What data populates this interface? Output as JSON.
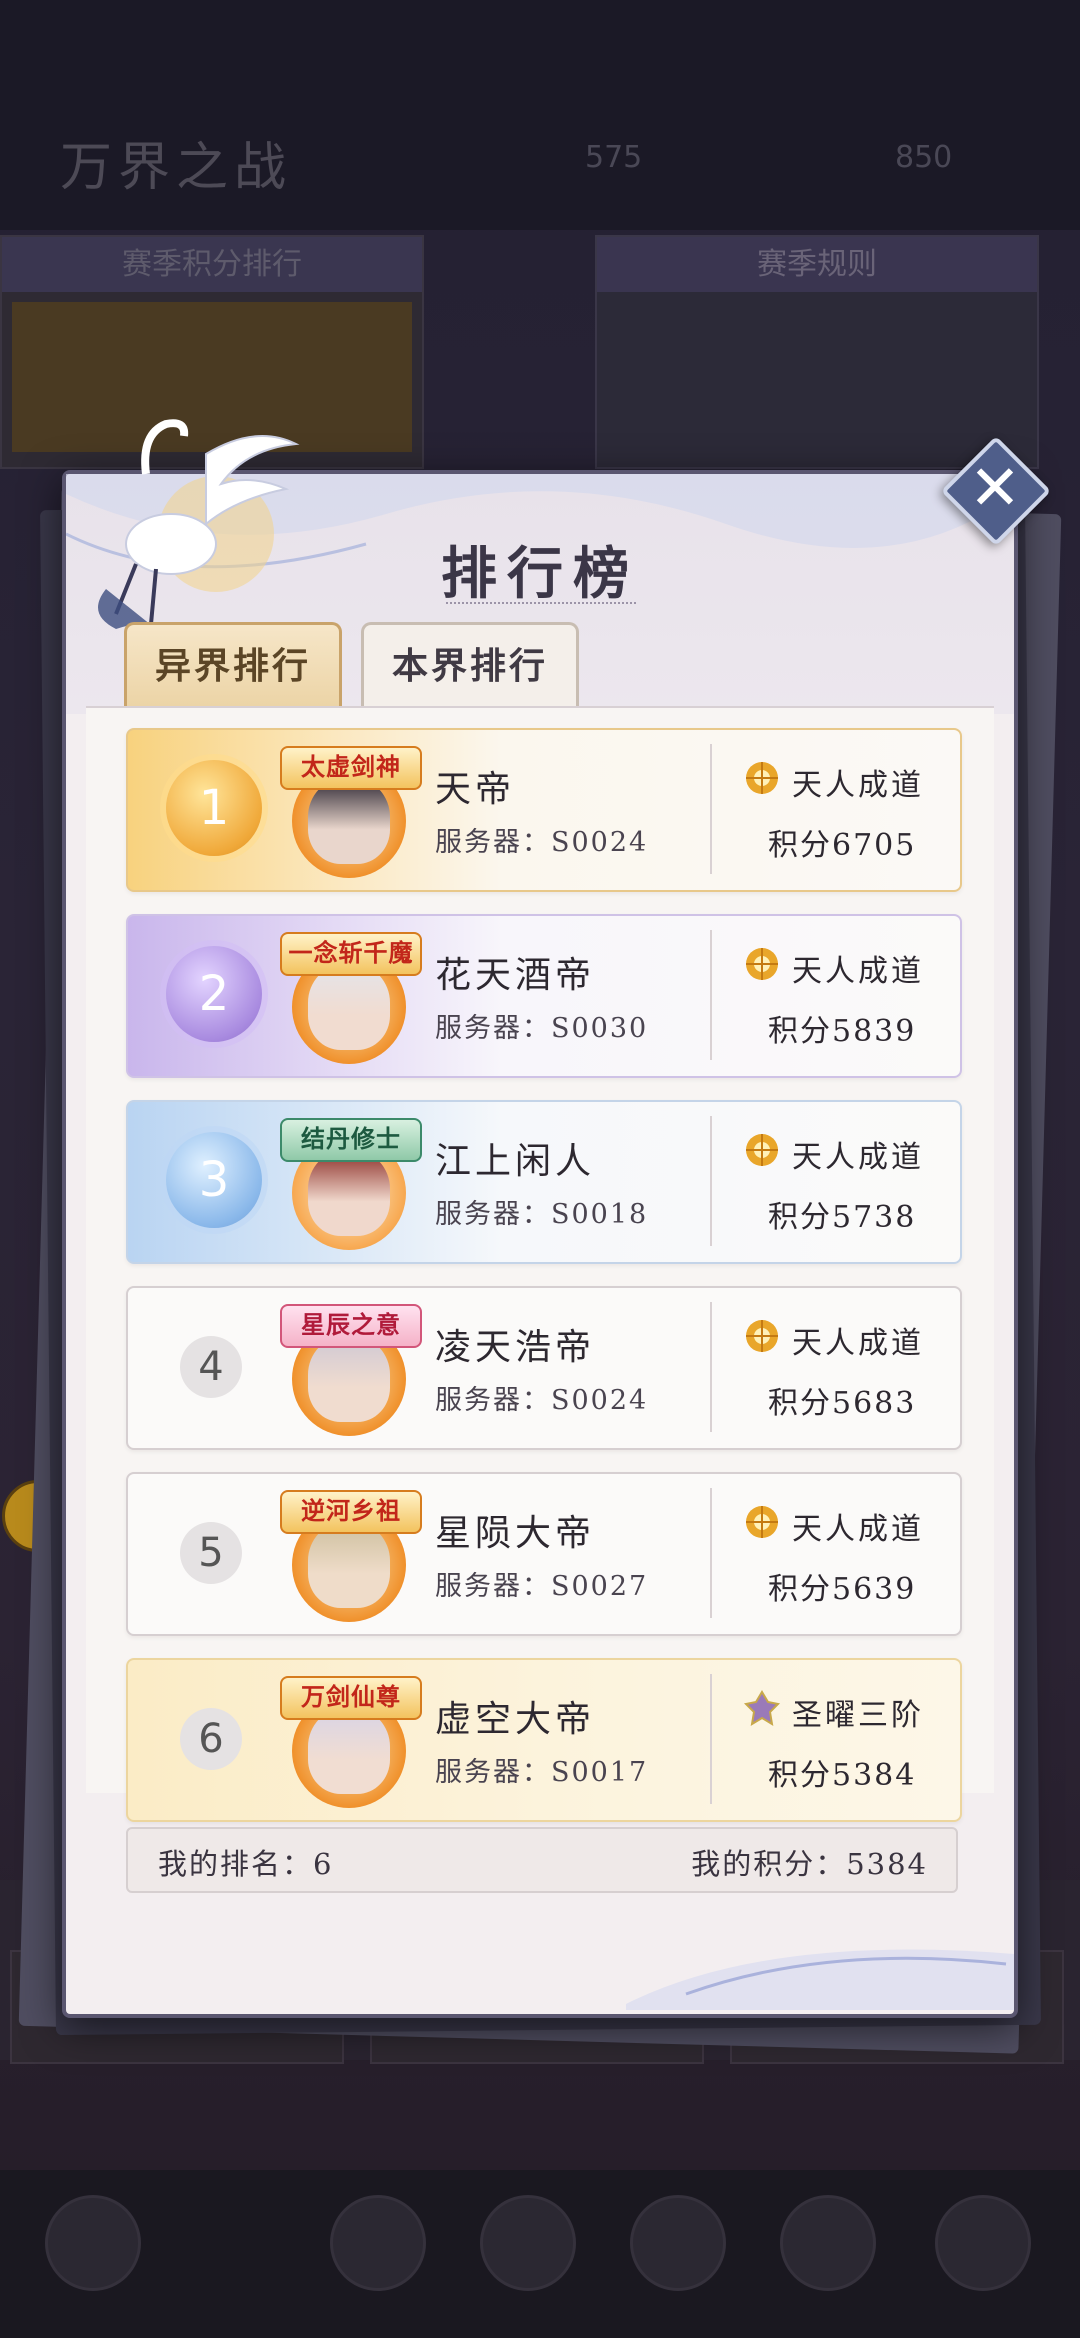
{
  "background": {
    "title": "万界之战",
    "stat_left": "575",
    "stat_right": "850",
    "panel_left_title": "赛季积分排行",
    "panel_right_title": "赛季规则"
  },
  "modal": {
    "title": "排行榜",
    "close_icon": "close-icon",
    "tabs": [
      {
        "label": "异界排行",
        "active": true
      },
      {
        "label": "本界排行",
        "active": false
      }
    ],
    "server_prefix": "服务器：",
    "rows": [
      {
        "rank": "1",
        "title_badge": "太虚剑神",
        "name": "天帝",
        "server": "S0024",
        "realm": "天人成道",
        "score": "积分6705"
      },
      {
        "rank": "2",
        "title_badge": "一念斩千魔",
        "name": "花天酒帝",
        "server": "S0030",
        "realm": "天人成道",
        "score": "积分5839"
      },
      {
        "rank": "3",
        "title_badge": "结丹修士",
        "name": "江上闲人",
        "server": "S0018",
        "realm": "天人成道",
        "score": "积分5738"
      },
      {
        "rank": "4",
        "title_badge": "星辰之意",
        "name": "凌天浩帝",
        "server": "S0024",
        "realm": "天人成道",
        "score": "积分5683"
      },
      {
        "rank": "5",
        "title_badge": "逆河乡祖",
        "name": "星陨大帝",
        "server": "S0027",
        "realm": "天人成道",
        "score": "积分5639"
      },
      {
        "rank": "6",
        "title_badge": "万剑仙尊",
        "name": "虚空大帝",
        "server": "S0017",
        "realm": "圣曜三阶",
        "score": "积分5384"
      }
    ],
    "footer": {
      "my_rank_label": "我的排名：6",
      "my_score_label": "我的积分：5384"
    }
  },
  "colors": {
    "gold": "#f0a93a",
    "purple": "#a98be0",
    "blue": "#8ab8ea",
    "close_bg": "#4f5e8a"
  }
}
